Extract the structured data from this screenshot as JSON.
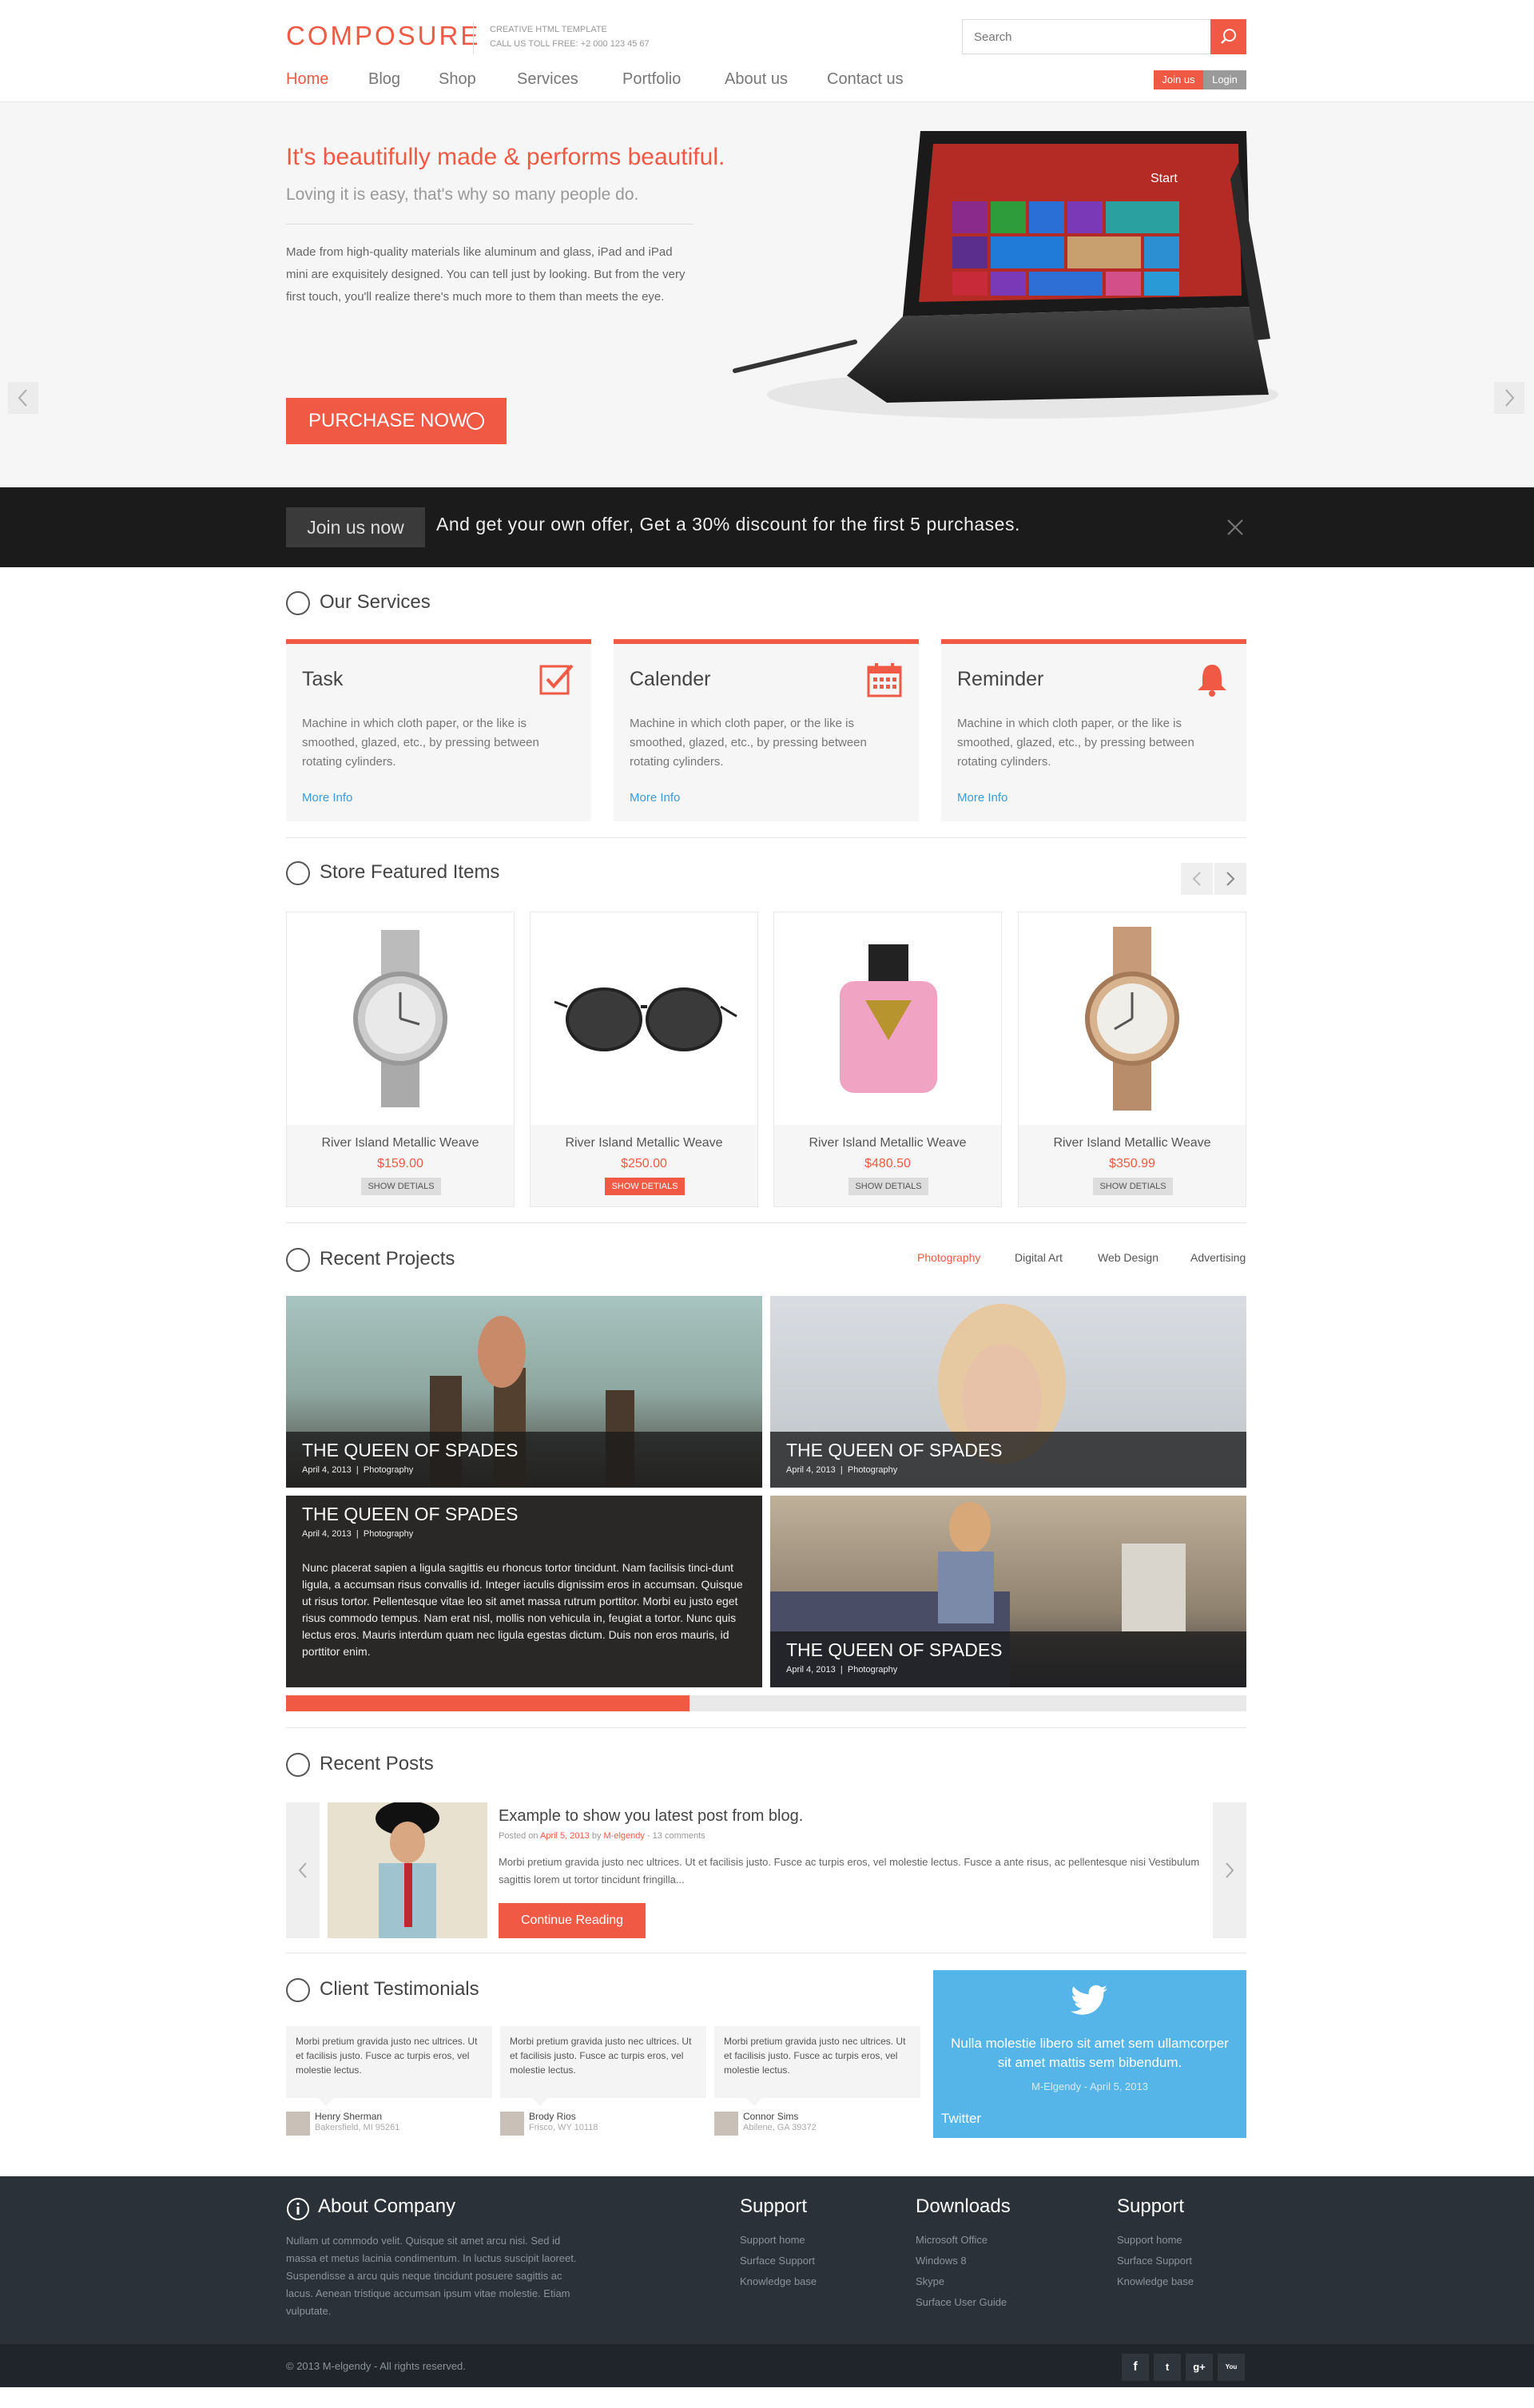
{
  "header": {
    "logo": "COMPOSURE",
    "tagline_line1": "CREATIVE HTML TEMPLATE",
    "tagline_line2": "CALL US TOLL FREE: +2 000 123 45 67",
    "search_placeholder": "Search",
    "nav": [
      "Home",
      "Blog",
      "Shop",
      "Services",
      "Portfolio",
      "About us",
      "Contact us"
    ],
    "join_label": "Join us",
    "login_label": "Login"
  },
  "hero": {
    "heading": "It's beautifully made & performs beautiful.",
    "subheading": "Loving it is easy, that's why so many people do.",
    "paragraph": "Made from high-quality materials like aluminum and glass, iPad and iPad mini are exquisitely designed. You can tell just by looking. But from the very first touch, you'll realize there's much more to them than meets the eye.",
    "button": "PURCHASE NOW",
    "tablet_screen_label": "Start"
  },
  "banner": {
    "tag": "Join us now",
    "text": "And get your own offer, Get a 30% discount for the first 5 purchases."
  },
  "services": {
    "title": "Our Services",
    "items": [
      {
        "title": "Task",
        "desc": "Machine in which cloth paper, or the like is smoothed, glazed, etc., by pressing between rotating cylinders.",
        "link": "More Info",
        "icon": "checkbox-icon"
      },
      {
        "title": "Calender",
        "desc": "Machine in which cloth paper, or the like is smoothed, glazed, etc., by pressing between rotating cylinders.",
        "link": "More Info",
        "icon": "calendar-icon"
      },
      {
        "title": "Reminder",
        "desc": "Machine in which cloth paper, or the like is smoothed, glazed, etc., by pressing between rotating cylinders.",
        "link": "More Info",
        "icon": "bell-icon"
      }
    ]
  },
  "store": {
    "title": "Store Featured Items",
    "items": [
      {
        "name": "River Island Metallic Weave",
        "price": "$159.00",
        "button": "SHOW DETIALS"
      },
      {
        "name": "River Island Metallic Weave",
        "price": "$250.00",
        "button": "SHOW DETIALS"
      },
      {
        "name": "River Island Metallic Weave",
        "price": "$480.50",
        "button": "SHOW DETIALS"
      },
      {
        "name": "River Island Metallic Weave",
        "price": "$350.99",
        "button": "SHOW DETIALS"
      }
    ]
  },
  "projects": {
    "title": "Recent Projects",
    "filters": [
      "Photography",
      "Digital Art",
      "Web Design",
      "Advertising"
    ],
    "progress": 0.42,
    "items": [
      {
        "title": "THE QUEEN OF SPADES",
        "date": "April 4, 2013",
        "category": "Photography"
      },
      {
        "title": "THE QUEEN OF SPADES",
        "date": "April 4, 2013",
        "category": "Photography"
      },
      {
        "title": "THE QUEEN OF SPADES",
        "date": "April 4, 2013",
        "category": "Photography",
        "desc": "Nunc placerat sapien a ligula sagittis eu rhoncus tortor tincidunt. Nam facilisis tinci-dunt ligula, a accumsan risus convallis id. Integer iaculis dignissim eros in accumsan. Quisque ut risus tortor. Pellentesque vitae leo sit amet massa rutrum porttitor. Morbi eu justo eget risus commodo tempus. Nam erat nisl, mollis non vehicula in, feugiat a tortor. Nunc quis lectus eros. Mauris interdum quam nec ligula egestas dictum. Duis non eros mauris, id porttitor enim."
      },
      {
        "title": "THE QUEEN OF SPADES",
        "date": "April 4, 2013",
        "category": "Photography"
      }
    ]
  },
  "posts": {
    "title": "Recent Posts",
    "post_title": "Example to show you latest post from blog.",
    "meta_prefix": "Posted on",
    "meta_date": "April 5, 2013",
    "meta_by": "by",
    "meta_author": "M-elgendy",
    "meta_comments": "- 13 comments",
    "excerpt": "Morbi pretium gravida justo nec ultrices. Ut et facilisis justo. Fusce ac turpis eros, vel molestie lectus. Fusce a ante risus, ac pellentesque nisi Vestibulum sagittis lorem ut tortor tincidunt fringilla...",
    "button": "Continue Reading"
  },
  "testimonials": {
    "title": "Client Testimonials",
    "items": [
      {
        "quote": "Morbi pretium gravida justo nec ultrices. Ut et facilisis justo. Fusce ac turpis eros, vel molestie lectus.",
        "name": "Henry Sherman",
        "location": "Bakersfield, MI 95261"
      },
      {
        "quote": "Morbi pretium gravida justo nec ultrices. Ut et facilisis justo. Fusce ac turpis eros, vel molestie lectus.",
        "name": "Brody Rios",
        "location": "Frisco, WY 10118"
      },
      {
        "quote": "Morbi pretium gravida justo nec ultrices. Ut et facilisis justo. Fusce ac turpis eros, vel molestie lectus.",
        "name": "Connor Sims",
        "location": "Abilene, GA 39372"
      }
    ],
    "twitter": {
      "text": "Nulla molestie libero sit amet sem ullamcorper sit amet mattis sem bibendum.",
      "date": "M-Elgendy - April 5, 2013",
      "label": "Twitter"
    }
  },
  "footer": {
    "about_title": "About Company",
    "about_text": "Nullam ut commodo velit. Quisque sit amet arcu nisi. Sed id massa et metus lacinia condimentum. In luctus suscipit laoreet. Suspendisse a arcu quis neque tincidunt posuere sagittis ac lacus. Aenean tristique accumsan ipsum vitae molestie. Etiam vulputate.",
    "col1_title": "Support",
    "col1_links": [
      "Support home",
      "Surface Support",
      "Knowledge base"
    ],
    "col2_title": "Downloads",
    "col2_links": [
      "Microsoft Office",
      "Windows 8",
      "Skype",
      "Surface User Guide"
    ],
    "col3_title": "Support",
    "col3_links": [
      "Support home",
      "Surface Support",
      "Knowledge base"
    ],
    "copyright": "© 2013 M-elgendy - All rights reserved.",
    "social": [
      "f",
      "t",
      "g+",
      "You Tube"
    ]
  },
  "colors": {
    "accent": "#f05a44",
    "link": "#3d9ad8",
    "twitter": "#55b4e8",
    "footer": "#2b3138"
  }
}
